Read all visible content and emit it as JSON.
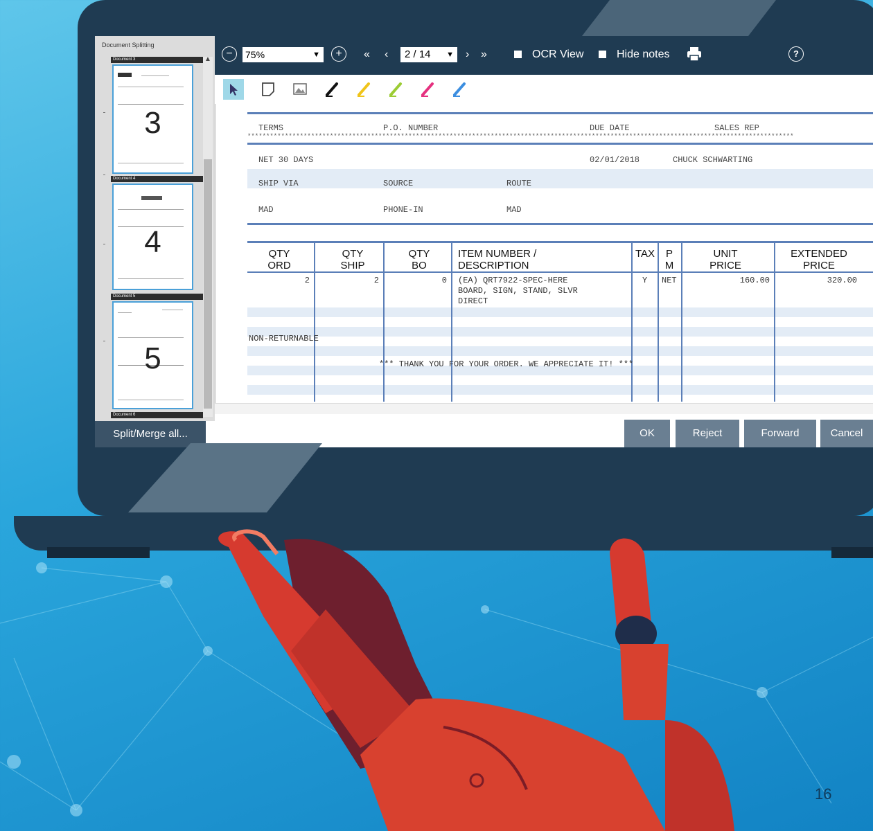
{
  "slide": {
    "page_number": "16"
  },
  "sidebar": {
    "title": "Document Splitting",
    "documents": [
      {
        "label": "Document 3",
        "page": "3"
      },
      {
        "label": "Document 4",
        "page": "4"
      },
      {
        "label": "Document 5",
        "page": "5"
      },
      {
        "label": "Document 6",
        "page": ""
      }
    ],
    "split_merge_label": "Split/Merge all..."
  },
  "toolbar": {
    "zoom_value": "75%",
    "page_value": "2 / 14",
    "ocr_view_label": "OCR View",
    "hide_notes_label": "Hide notes",
    "icons": [
      "zoom-out-icon",
      "zoom-in-icon",
      "first-page-icon",
      "prev-page-icon",
      "next-page-icon",
      "last-page-icon",
      "print-icon",
      "help-icon"
    ]
  },
  "annotation_tools": {
    "icons": [
      "select-arrow-icon",
      "sticky-note-icon",
      "image-icon",
      "pen-black-icon",
      "pen-yellow-icon",
      "pen-green-icon",
      "pen-pink-icon",
      "pen-blue-icon"
    ],
    "colors": {
      "black": "#111111",
      "yellow": "#f0c419",
      "green": "#9ccc34",
      "pink": "#e5317f",
      "blue": "#3c8ee0"
    }
  },
  "document": {
    "header_labels": {
      "terms": "TERMS",
      "po_number": "P.O. NUMBER",
      "due_date": "DUE DATE",
      "sales_rep": "SALES REP"
    },
    "terms": "NET 30 DAYS",
    "due_date": "02/01/2018",
    "sales_rep": "CHUCK SCHWARTING",
    "ship_labels": {
      "ship_via": "SHIP VIA",
      "source": "SOURCE",
      "route": "ROUTE"
    },
    "ship_via": "MAD",
    "source": "PHONE-IN",
    "route": "MAD",
    "columns": {
      "qty_ord": [
        "QTY",
        "ORD"
      ],
      "qty_ship": [
        "QTY",
        "SHIP"
      ],
      "qty_bo": [
        "QTY",
        "BO"
      ],
      "item": [
        "ITEM NUMBER /",
        "DESCRIPTION"
      ],
      "tax": [
        "TAX",
        ""
      ],
      "pm": [
        "P",
        "M"
      ],
      "unit_price": [
        "UNIT",
        "PRICE"
      ],
      "extended_price": [
        "EXTENDED",
        "PRICE"
      ]
    },
    "line_item": {
      "qty_ord": "2",
      "qty_ship": "2",
      "qty_bo": "0",
      "item_line1": "(EA) QRT7922-SPEC-HERE",
      "item_line2": "BOARD, SIGN, STAND, SLVR",
      "item_line3": "DIRECT",
      "tax": "Y",
      "pm": "NET",
      "unit_price": "160.00",
      "extended_price": "320.00"
    },
    "note": "NON-RETURNABLE",
    "thanks": "*** THANK YOU FOR YOUR ORDER. WE APPRECIATE IT! ***"
  },
  "actions": {
    "ok": "OK",
    "reject": "Reject",
    "forward": "Forward",
    "cancel": "Cancel"
  }
}
